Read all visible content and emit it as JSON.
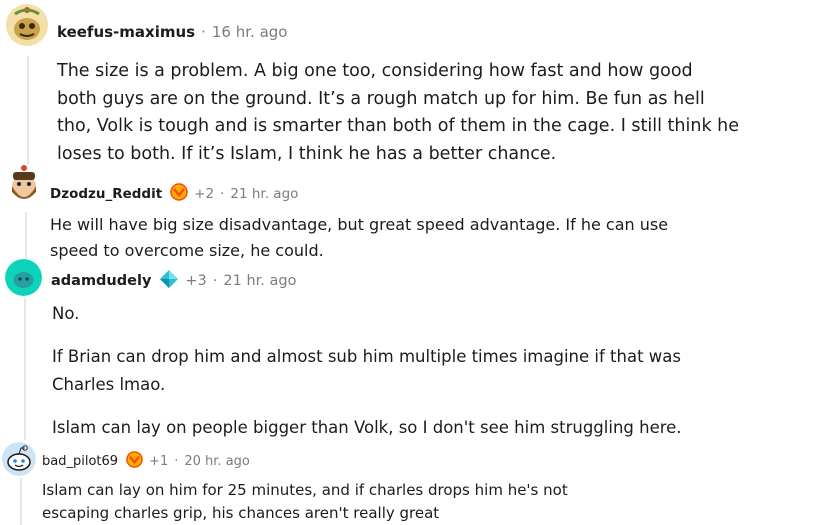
{
  "colors": {
    "text": "#1c1c1c",
    "meta": "#7c7c7c",
    "thread": "#e6e6e6"
  },
  "comments": [
    {
      "username": "keefus-maximus",
      "separator": "·",
      "time": "16 hr. ago",
      "avatar_icon": "snoo-avatar-icon",
      "paragraphs": [
        "The size is a problem. A big one too, considering how fast and how good",
        "both guys are on the ground. It’s a rough match up for him. Be fun as hell",
        "tho, Volk is tough and is smarter than both of them in the cage. I still think he",
        "loses to both. If it’s Islam, I think he has a better chance."
      ]
    },
    {
      "username": "Dzodzu_Reddit",
      "award_icon": "flair-award-icon",
      "score": "+2",
      "separator": "·",
      "time": "21 hr. ago",
      "avatar_icon": "bearded-snoo-avatar-icon",
      "paragraphs": [
        "He will have big size disadvantage, but great speed advantage. If he can use",
        "speed to overcome size, he could."
      ]
    },
    {
      "username": "adamdudely",
      "award_icon": "diamond-flair-icon",
      "score": "+3",
      "separator": "·",
      "time": "21 hr. ago",
      "avatar_icon": "teal-avatar-icon",
      "paragraphs": [
        "No.",
        "If Brian can drop him and almost sub him multiple times imagine if that was",
        "Charles lmao.",
        "Islam can lay on people bigger than Volk, so I don't see him struggling here."
      ]
    },
    {
      "username": "bad_pilot69",
      "award_icon": "flair-award-icon",
      "score": "+1",
      "separator": "·",
      "time": "20 hr. ago",
      "avatar_icon": "default-snoo-avatar-icon",
      "paragraphs": [
        "Islam can lay on him for 25 minutes, and if charles drops him he's not",
        "escaping charles grip, his chances aren't really great"
      ]
    }
  ]
}
